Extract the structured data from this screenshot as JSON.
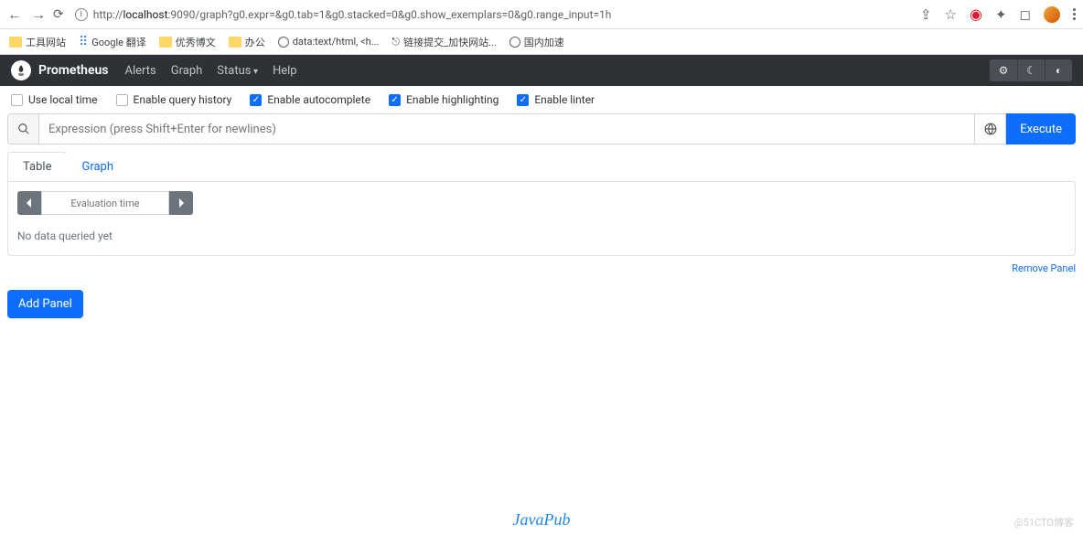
{
  "browser": {
    "url_prefix": "http://",
    "url_host": "localhost",
    "url_rest": ":9090/graph?g0.expr=&g0.tab=1&g0.stacked=0&g0.show_exemplars=0&g0.range_input=1h"
  },
  "bookmarks": {
    "items": [
      {
        "label": "工具网站",
        "type": "folder"
      },
      {
        "label": "Google 翻译",
        "type": "gt"
      },
      {
        "label": "优秀博文",
        "type": "folder"
      },
      {
        "label": "办公",
        "type": "folder"
      },
      {
        "label": "data:text/html, <h...",
        "type": "globe"
      },
      {
        "label": "链接提交_加快网站...",
        "type": "link"
      },
      {
        "label": "国内加速",
        "type": "globe"
      }
    ]
  },
  "navbar": {
    "brand": "Prometheus",
    "links": {
      "alerts": "Alerts",
      "graph": "Graph",
      "status": "Status",
      "help": "Help"
    }
  },
  "options": {
    "localTime": {
      "label": "Use local time",
      "checked": false
    },
    "queryHistory": {
      "label": "Enable query history",
      "checked": false
    },
    "autocomplete": {
      "label": "Enable autocomplete",
      "checked": true
    },
    "highlighting": {
      "label": "Enable highlighting",
      "checked": true
    },
    "linter": {
      "label": "Enable linter",
      "checked": true
    }
  },
  "expression": {
    "placeholder": "Expression (press Shift+Enter for newlines)",
    "executeLabel": "Execute"
  },
  "tabs": {
    "table": "Table",
    "graph": "Graph"
  },
  "panel": {
    "evalPlaceholder": "Evaluation time",
    "noData": "No data queried yet",
    "removeLabel": "Remove Panel",
    "addLabel": "Add Panel"
  },
  "footer": {
    "javapub": "JavaPub",
    "watermark": "@51CTO博客"
  }
}
